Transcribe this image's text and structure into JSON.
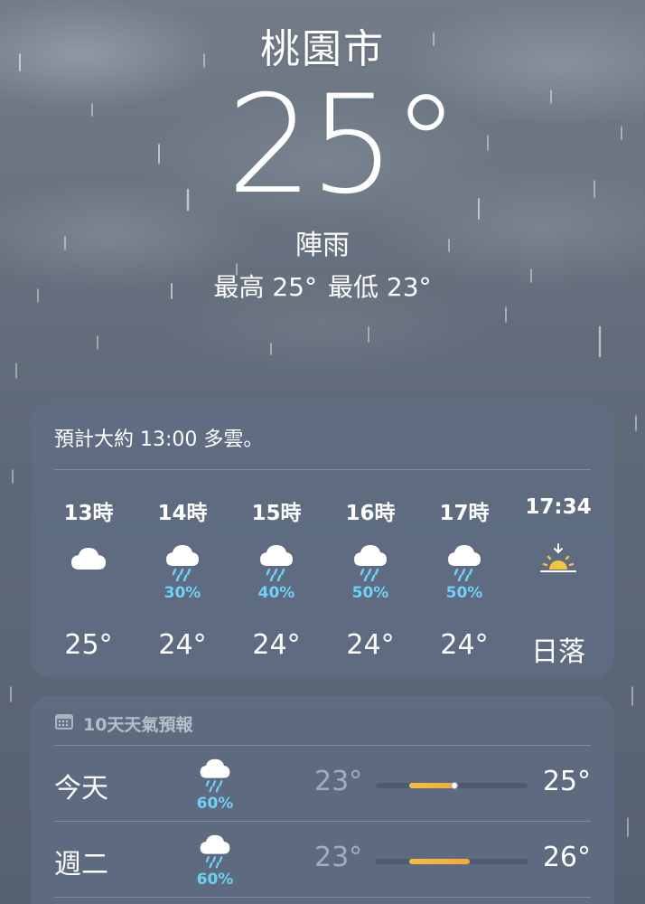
{
  "location": {
    "city": "桃園市",
    "temperature": "25°",
    "condition": "陣雨",
    "high": "最高 25°",
    "low": "最低 23°"
  },
  "hourly": {
    "summary": "預計大約 13:00 多雲。",
    "items": [
      {
        "time": "13時",
        "icon": "cloud-icon",
        "prob": "",
        "temp": "25°"
      },
      {
        "time": "14時",
        "icon": "cloud-rain-icon",
        "prob": "30%",
        "temp": "24°"
      },
      {
        "time": "15時",
        "icon": "cloud-rain-icon",
        "prob": "40%",
        "temp": "24°"
      },
      {
        "time": "16時",
        "icon": "cloud-rain-icon",
        "prob": "50%",
        "temp": "24°"
      },
      {
        "time": "17時",
        "icon": "cloud-rain-icon",
        "prob": "50%",
        "temp": "24°"
      },
      {
        "time": "17:34",
        "icon": "sunset-icon",
        "prob": "",
        "temp": "日落"
      }
    ]
  },
  "daily": {
    "title": "10天天氣預報",
    "icon": "calendar-icon",
    "days": [
      {
        "name": "今天",
        "icon": "cloud-rain-icon",
        "prob": "60%",
        "low": "23°",
        "high": "25°",
        "bar_start": 0.22,
        "bar_end": 0.52,
        "current": 0.52
      },
      {
        "name": "週二",
        "icon": "cloud-rain-icon",
        "prob": "60%",
        "low": "23°",
        "high": "26°",
        "bar_start": 0.22,
        "bar_end": 0.62
      }
    ]
  },
  "colors": {
    "precip": "#6ed2f6",
    "bar": "#f2c043",
    "sun": "#f5c342"
  }
}
